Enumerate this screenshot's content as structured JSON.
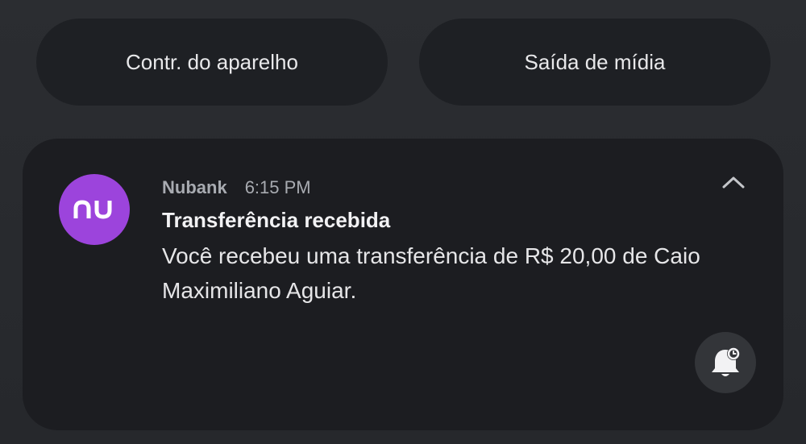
{
  "quick_settings": {
    "device_controls_label": "Contr. do aparelho",
    "media_output_label": "Saída de mídia"
  },
  "notification": {
    "app_name": "Nubank",
    "time": "6:15 PM",
    "title": "Transferência recebida",
    "body": "Você recebeu uma transferência de R$ 20,00 de Caio Maximiliano Aguiar.",
    "app_icon_text": "nu",
    "app_icon_color": "#9c44dc",
    "collapse_icon": "chevron-up-icon",
    "snooze_icon": "bell-snooze-icon"
  }
}
